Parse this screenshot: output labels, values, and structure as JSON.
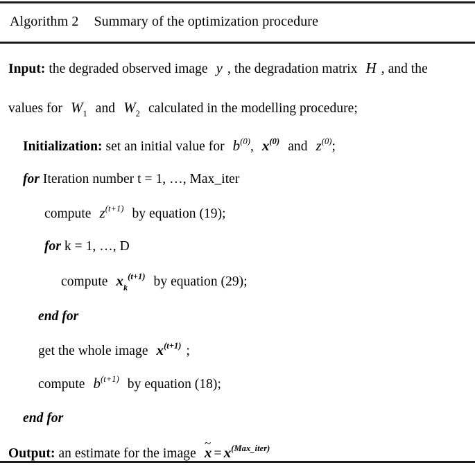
{
  "document": {
    "kind": "algorithm-pseudocode-block",
    "title": {
      "label": "Algorithm 2",
      "caption": "Summary of the optimization procedure"
    },
    "rules": {
      "top": true,
      "middle": true,
      "bottom": true,
      "color": "#1a1a1a"
    },
    "lines": [
      {
        "id": "input-line-1",
        "indent": 0,
        "keyword": "Input:",
        "text_before": " the degraded observed image",
        "var_1": "y",
        "text_mid": ", the degradation matrix",
        "var_2": "H",
        "text_after": ", and the"
      },
      {
        "id": "input-line-2",
        "indent": 0,
        "text_before": "values for",
        "var_1": "W",
        "var_1_sub": "1",
        "text_mid": "and",
        "var_2": "W",
        "var_2_sub": "2",
        "text_after": "calculated in the modelling procedure;"
      },
      {
        "id": "initialization-line",
        "indent": 1,
        "keyword": "Initialization:",
        "text_before": " set an initial value for",
        "var_1": "b",
        "var_1_sup": "(0)",
        "text_mid": ",",
        "var_2": "x",
        "var_2_sup": "(0)",
        "text_mid_2": "and",
        "var_3": "z",
        "var_3_sup": "(0)",
        "text_after": ";"
      },
      {
        "id": "for-outer-line",
        "indent": 1,
        "keyword": "for",
        "text_after": " Iteration number t = 1, …, Max_iter"
      },
      {
        "id": "compute-z-line",
        "indent": 2,
        "text_before": "compute",
        "var_1": "z",
        "var_1_sup": "(t+1)",
        "text_after": "by equation (19);"
      },
      {
        "id": "for-inner-line",
        "indent": 2,
        "keyword": "for",
        "text_after": " k = 1, …, D"
      },
      {
        "id": "compute-x-k-line",
        "indent": 3,
        "text_before": "compute",
        "var_1": "x",
        "var_1_sub": "k",
        "var_1_sup": "(t+1)",
        "text_after": "by equation (29);"
      },
      {
        "id": "end-for-inner-line",
        "indent": 2,
        "keyword": "end for"
      },
      {
        "id": "get-image-line",
        "indent": 2,
        "text_before": "get the whole image",
        "var_1": "x",
        "var_1_sup": "(t+1)",
        "text_after": ";"
      },
      {
        "id": "compute-b-line",
        "indent": 2,
        "text_before": "compute",
        "var_1": "b",
        "var_1_sup": "(t+1)",
        "text_after": "by equation (18);"
      },
      {
        "id": "end-for-outer-line",
        "indent": 1,
        "keyword": "end for"
      },
      {
        "id": "output-line",
        "indent": 0,
        "keyword": "Output:",
        "text_before": " an estimate for the image",
        "var_1": "x",
        "var_1_accent": "~",
        "equals": "=",
        "var_2": "x",
        "var_2_sup": "(Max_iter)"
      }
    ]
  }
}
